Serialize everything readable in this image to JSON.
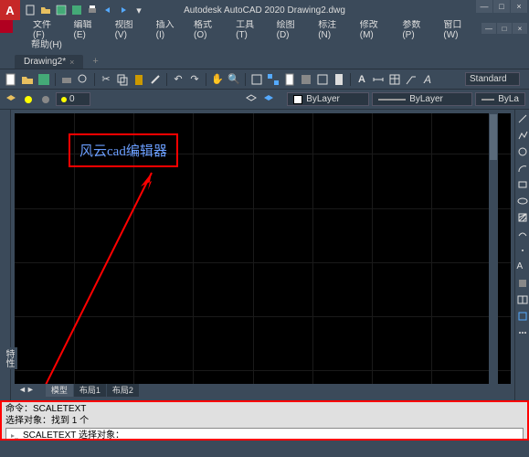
{
  "app": {
    "letter": "A",
    "title": "Autodesk AutoCAD 2020   Drawing2.dwg"
  },
  "menu": {
    "file": "文件(F)",
    "edit": "编辑(E)",
    "view": "视图(V)",
    "insert": "插入(I)",
    "format": "格式(O)",
    "tools": "工具(T)",
    "draw": "绘图(D)",
    "dimension": "标注(N)",
    "modify": "修改(M)",
    "parametric": "参数(P)",
    "window": "窗口(W)"
  },
  "helpbar": {
    "help": "帮助(H)"
  },
  "tabs": {
    "active": "Drawing2*",
    "add": "+"
  },
  "style": {
    "label": "Standard"
  },
  "props": {
    "layer": "0",
    "color": "ByLayer",
    "linetype": "ByLayer",
    "lineweight": "ByLa"
  },
  "canvas": {
    "text": "风云cad编辑器"
  },
  "model_tabs": {
    "model": "模型",
    "layout1": "布局1",
    "layout2": "布局2"
  },
  "cmd": {
    "line1": "命令：SCALETEXT",
    "line2": "选择对象：找到 1 个",
    "prompt": "SCALETEXT 选择对象："
  },
  "side": {
    "label": "特性"
  },
  "win": {
    "min": "—",
    "max": "□",
    "close": "×"
  }
}
